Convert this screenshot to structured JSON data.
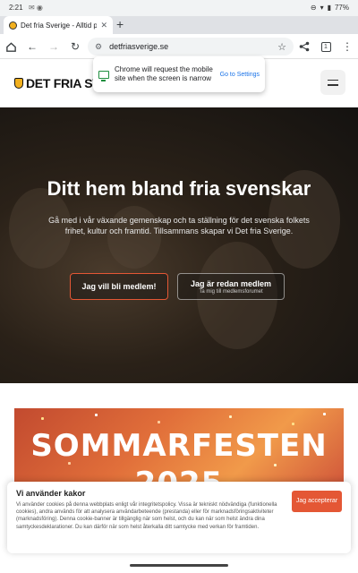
{
  "status_bar": {
    "time": "2:21",
    "battery": "77%"
  },
  "tab": {
    "title": "Det fria Sverige - Alltid på"
  },
  "omnibox": {
    "url": "detfriasverige.se",
    "tab_count": "1"
  },
  "site": {
    "logo_text": "DET FRIA SVE"
  },
  "popup": {
    "message": "Chrome will request the mobile site when the screen is narrow",
    "link": "Go to Settings"
  },
  "hero": {
    "title": "Ditt hem bland fria svenskar",
    "subtitle": "Gå med i vår växande gemenskap och ta ställning för det svenska folkets frihet,  kultur och framtid. Tillsammans skapar vi Det fria Sverige.",
    "primary_button": "Jag vill bli medlem!",
    "secondary_button": "Jag är redan medlem",
    "secondary_sub": "Ta mig till medlemsforumet"
  },
  "promo": {
    "title": "SOMMARFESTEN",
    "year": "2025"
  },
  "cookie": {
    "title": "Vi använder kakor",
    "text": "Vi använder cookies på denna webbplats enligt vår integritetspolicy. Vissa är tekniskt nödvändiga (funktionella cookies), andra används för att analysera användarbeteende (prestanda) eller för marknadsföringsaktiviteter (marknadsföring). Denna cookie-banner är tillgänglig när som helst, och du kan när som helst ändra dina samtyckesdeklarationer. Du kan därför när som helst återkalla ditt samtycke med verkan för framtiden.",
    "accept": "Jag accepterar"
  }
}
